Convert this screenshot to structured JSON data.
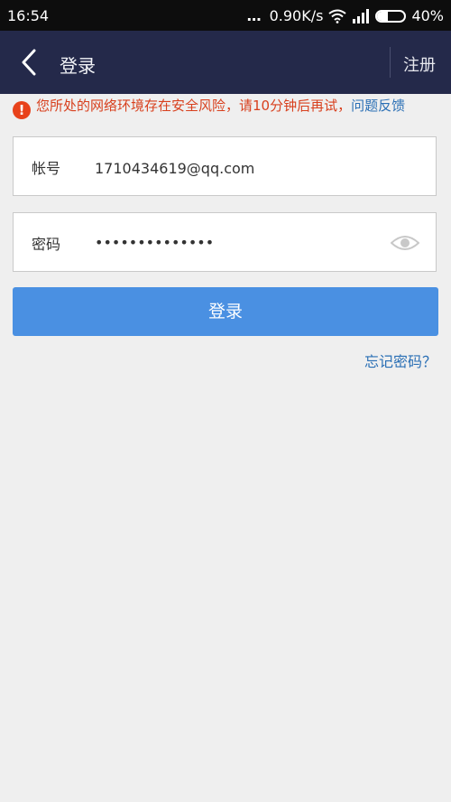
{
  "status_bar": {
    "time": "16:54",
    "network_speed": "0.90K/s",
    "battery_percent": "40%",
    "battery_level": 0.4
  },
  "header": {
    "title": "登录",
    "register_label": "注册",
    "back_icon": "chevron-left-icon"
  },
  "warning": {
    "icon": "exclamation-icon",
    "message": "您所处的网络环境存在安全风险，请10分钟后再试，",
    "link_text": "问题反馈"
  },
  "account_field": {
    "label": "帐号",
    "value": "1710434619@qq.com"
  },
  "password_field": {
    "label": "密码",
    "masked_value": "••••••••••••••",
    "toggle_icon": "eye-icon"
  },
  "login_button": {
    "label": "登录"
  },
  "forgot_link": {
    "label": "忘记密码？"
  },
  "colors": {
    "header_bg": "#24294a",
    "primary": "#4a90e2",
    "warning": "#d8401e",
    "link": "#2a6fb5"
  }
}
